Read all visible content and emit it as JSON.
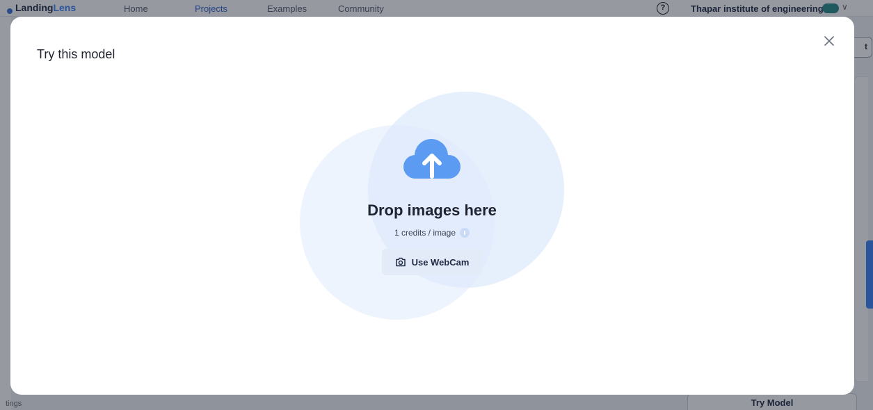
{
  "app": {
    "logo": {
      "name_part1": "Landing",
      "name_part2": "Lens"
    },
    "nav": [
      {
        "label": "Home"
      },
      {
        "label": "Projects",
        "active": true
      },
      {
        "label": "Examples"
      },
      {
        "label": "Community"
      }
    ],
    "help_label": "?",
    "org_name": "Thapar institute of engineering",
    "left_rail_label": "tings",
    "right_button_label": "t",
    "try_model_label": "Try Model"
  },
  "modal": {
    "title": "Try this model",
    "close_icon": "close-icon",
    "dropzone": {
      "icon": "cloud-upload-icon",
      "title": "Drop images here",
      "credits": "1 credits / image",
      "info_icon": "info-icon",
      "webcam_icon": "camera-icon",
      "webcam_label": "Use WebCam"
    }
  },
  "colors": {
    "accent": "#3b82f6",
    "upload_icon": "#5b9cf2",
    "webcam_button_bg": "#e3ebf8",
    "overlay": "rgba(22,28,45,0.45)"
  }
}
